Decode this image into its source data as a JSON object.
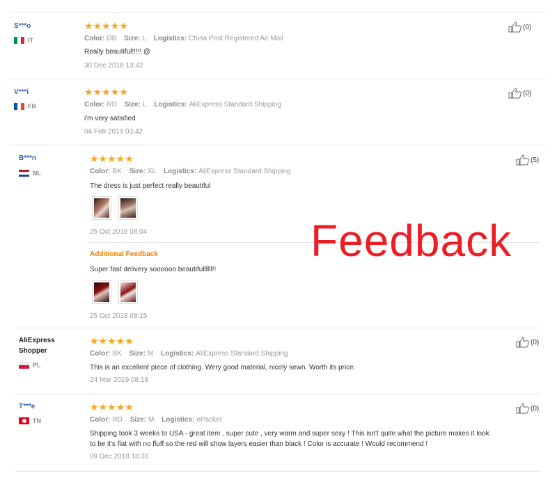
{
  "overlay_text": "Feedback",
  "meta_labels": {
    "color": "Color:",
    "size": "Size:",
    "logistics": "Logistics:"
  },
  "reviews": [
    {
      "user": "S***o",
      "country": "IT",
      "stars": "★★★★★",
      "color": "DB",
      "size": "L",
      "logistics": "China Post Registered Air Mail",
      "text": "Really beautiful!!!!! @",
      "date": "30 Dec 2018 13:42",
      "likes": "(0)"
    },
    {
      "user": "V***i",
      "country": "FR",
      "stars": "★★★★★",
      "color": "RD",
      "size": "L",
      "logistics": "AliExpress Standard Shipping",
      "text": "i'm very satisfied",
      "date": "04 Feb 2019 03:42",
      "likes": "(0)"
    },
    {
      "user": "B***n",
      "country": "NL",
      "stars": "★★★★★",
      "color": "BK",
      "size": "XL",
      "logistics": "AliExpress Standard Shipping",
      "text": "The dress is just perfect really beautiful",
      "date": "25 Oct 2018 08:04",
      "likes": "(5)",
      "additional_label": "Additional Feedback",
      "additional_text": "Super fast delivery soooooo beautifullllll!!",
      "additional_date": "25 Oct 2018 08:15"
    },
    {
      "user_line1": "AliExpress",
      "user_line2": "Shopper",
      "country": "PL",
      "stars": "★★★★★",
      "color": "BK",
      "size": "M",
      "logistics": "AliExpress Standard Shipping",
      "text": "This is an excellent piece of clothing. Wery good material, nicely sewn. Worth its price.",
      "date": "24 Mar 2019 08:18",
      "likes": "(0)"
    },
    {
      "user": "T***e",
      "country": "TN",
      "stars": "★★★★★",
      "color": "RD",
      "size": "M",
      "logistics": "ePacket",
      "text_line1": "Shipping took 3 weeks to USA - great item , super cute , very warm and super sexy ! This isn't quite what the picture makes it look",
      "text_line2": "to be it's flat with no fluff so the red will show layers easier than black ! Color is accurate ! Would recommend !",
      "date": "09 Dec 2018 18:31",
      "likes": "(0)"
    }
  ],
  "colors": {
    "star": "#f5a623",
    "username": "#2d64b3",
    "additional": "#e87f00",
    "overlay": "#ee1c25"
  },
  "icons": {
    "like": "thumbs-up-icon",
    "star": "star-icon"
  }
}
